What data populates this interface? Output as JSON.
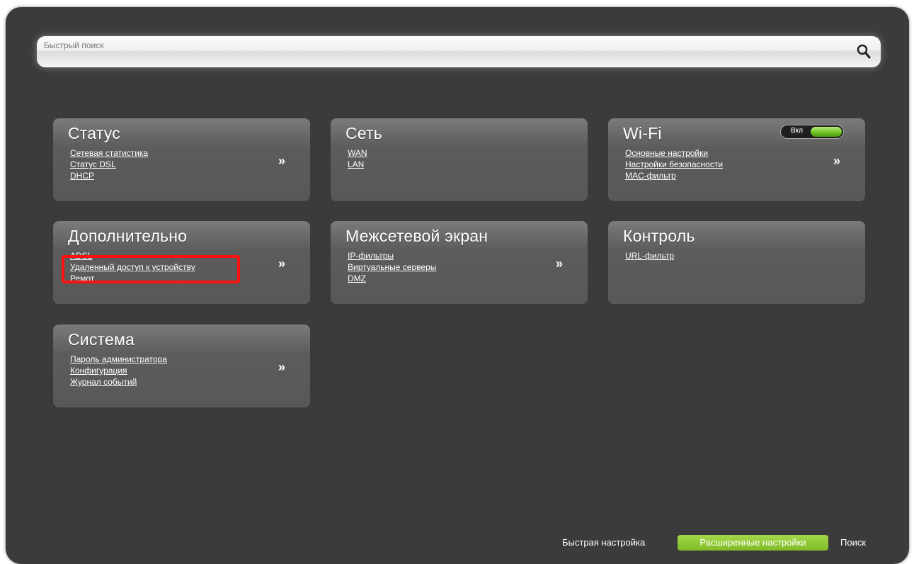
{
  "search": {
    "placeholder": "Быстрый поиск"
  },
  "tiles": {
    "status": {
      "title": "Статус",
      "links": [
        "Сетевая статистика",
        "Статус DSL",
        "DHCP"
      ],
      "arrow": "»"
    },
    "network": {
      "title": "Сеть",
      "links": [
        "WAN",
        "LAN"
      ]
    },
    "wifi": {
      "title": "Wi-Fi",
      "toggle_label": "Вкл",
      "links": [
        "Основные настройки",
        "Настройки безопасности",
        "MAC-фильтр"
      ],
      "arrow": "»"
    },
    "advanced": {
      "title": "Дополнительно",
      "links": [
        "ADSL",
        "Удаленный доступ к устройству",
        "Ремот"
      ],
      "arrow": "»"
    },
    "firewall": {
      "title": "Межсетевой экран",
      "links": [
        "IP-фильтры",
        "Виртуальные серверы",
        "DMZ"
      ],
      "arrow": "»"
    },
    "control": {
      "title": "Контроль",
      "links": [
        "URL-фильтр"
      ]
    },
    "system": {
      "title": "Система",
      "links": [
        "Пароль администратора",
        "Конфигурация",
        "Журнал событий"
      ],
      "arrow": "»"
    }
  },
  "bottom_nav": {
    "quick_setup": "Быстрая настройка",
    "advanced_settings": "Расширенные настройки",
    "search": "Поиск"
  },
  "colors": {
    "background": "#3b3b3b",
    "tile": "#5c5c5c",
    "accent_green": "#7fbc26",
    "highlight_red": "#ff1010"
  }
}
